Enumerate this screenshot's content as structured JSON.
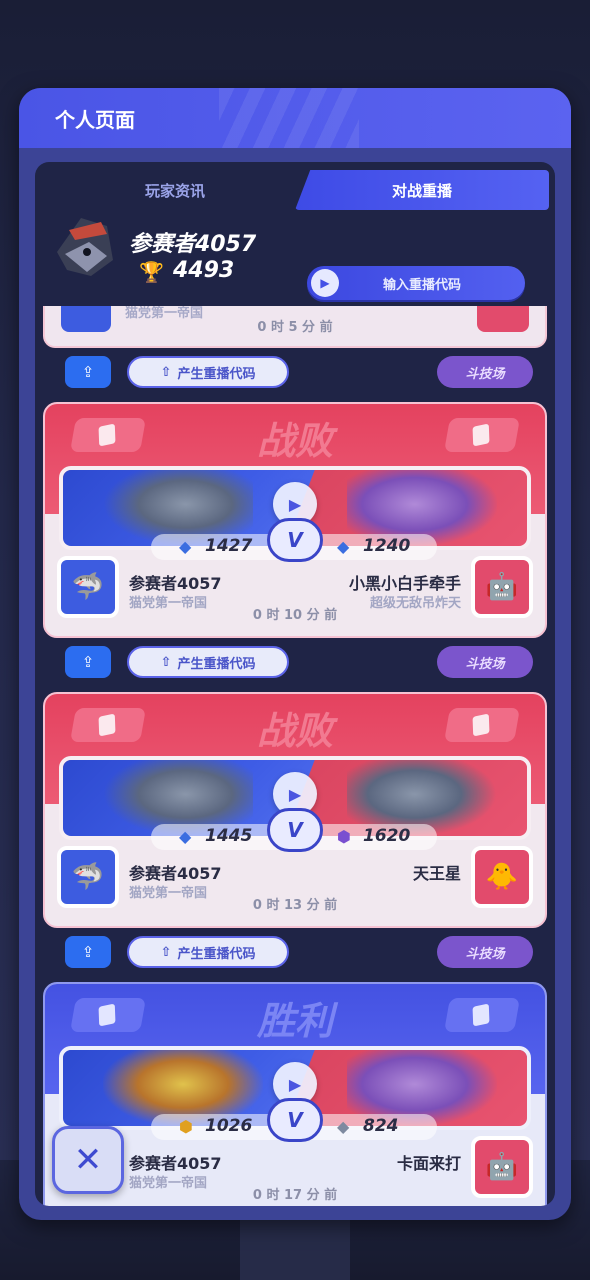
{
  "panel": {
    "title": "个人页面"
  },
  "tabs": [
    {
      "label": "玩家资讯",
      "active": false
    },
    {
      "label": "对战重播",
      "active": true
    }
  ],
  "profile": {
    "name": "参赛者4057",
    "trophies": "4493",
    "replay_code_button": "输入重播代码",
    "avatar_icon": "shark-icon",
    "trophy_icon": "trophy-icon"
  },
  "partial_card": {
    "subtitle": "猫党第一帝国",
    "time": "0 时 5 分 前"
  },
  "actions": {
    "share_icon": "share-icon",
    "generate_label": "产生重播代码",
    "arena_label": "斗技场"
  },
  "matches": [
    {
      "result": "战败",
      "result_type": "loss",
      "left_score": "1427",
      "right_score": "1240",
      "left_name": "参赛者4057",
      "left_sub": "猫党第一帝国",
      "right_name": "小黑小白手牵手",
      "right_sub": "超级无敌吊炸天",
      "time": "0 时 10 分 前"
    },
    {
      "result": "战败",
      "result_type": "loss",
      "left_score": "1445",
      "right_score": "1620",
      "left_name": "参赛者4057",
      "left_sub": "猫党第一帝国",
      "right_name": "天王星",
      "right_sub": "",
      "time": "0 时 13 分 前"
    },
    {
      "result": "胜利",
      "result_type": "win",
      "left_score": "1026",
      "right_score": "824",
      "left_name": "参赛者4057",
      "left_sub": "猫党第一帝国",
      "right_name": "卡面来打",
      "right_sub": "",
      "time": "0 时 17 分 前"
    }
  ],
  "colors": {
    "accent": "#4a55e6",
    "loss": "#e4425f",
    "win": "#4452e2"
  }
}
